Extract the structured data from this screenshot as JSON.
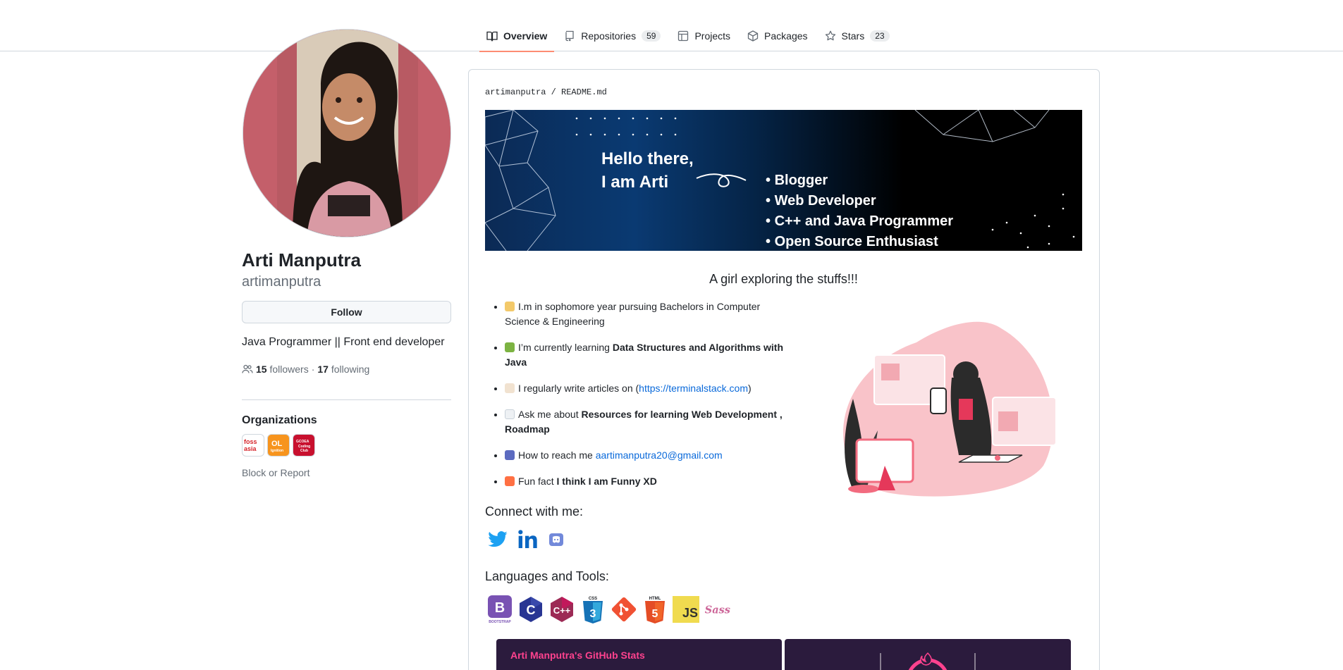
{
  "nav": {
    "tabs": [
      {
        "label": "Overview",
        "icon": "book-icon",
        "active": true
      },
      {
        "label": "Repositories",
        "icon": "repo-icon",
        "count": "59"
      },
      {
        "label": "Projects",
        "icon": "table-icon"
      },
      {
        "label": "Packages",
        "icon": "package-icon"
      },
      {
        "label": "Stars",
        "icon": "star-icon",
        "count": "23"
      }
    ]
  },
  "profile": {
    "name": "Arti Manputra",
    "login": "artimanputra",
    "follow_label": "Follow",
    "bio": "Java Programmer || Front end developer",
    "followers_count": "15",
    "followers_label": "followers",
    "separator": "·",
    "following_count": "17",
    "following_label": "following",
    "organizations_title": "Organizations",
    "orgs": [
      "foss asia",
      "OSL",
      "GCOEA Coding Club"
    ],
    "block_label": "Block or Report"
  },
  "readme": {
    "owner": "artimanputra",
    "slash": "/",
    "file": "README.md",
    "banner": {
      "hello_line1": "Hello there,",
      "hello_line2": "I am Arti",
      "items": [
        "Blogger",
        "Web Developer",
        "C++ and Java Programmer",
        "Open Source Enthusiast"
      ]
    },
    "tagline": "A girl exploring the stuffs!!!",
    "bullets": {
      "b1_text": "I.m in sophomore year pursuing Bachelors in Computer Science & Engineering",
      "b2_pre": "I’m currently learning ",
      "b2_bold": "Data Structures and Algorithms with Java",
      "b3_pre": "I regularly write articles on (",
      "b3_link": "https://terminalstack.com",
      "b3_post": ")",
      "b4_pre": "Ask me about ",
      "b4_bold": "Resources for learning Web Development , Roadmap",
      "b5_pre": "How to reach me ",
      "b5_link": "aartimanputra20@gmail.com",
      "b6_pre": "Fun fact ",
      "b6_bold": "I think I am Funny XD"
    },
    "connect_title": "Connect with me:",
    "socials": [
      "twitter-icon",
      "linkedin-icon",
      "discord-icon"
    ],
    "languages_title": "Languages and Tools:",
    "tools": [
      "bootstrap-icon",
      "c-icon",
      "cplusplus-icon",
      "css3-icon",
      "git-icon",
      "html5-icon",
      "javascript-icon",
      "sass-icon"
    ],
    "tool_text": {
      "bootstrap": "B",
      "bootstrap_caption": "BOOTSTRAP",
      "c": "C",
      "cpp": "C++",
      "css": "CSS",
      "css_n": "3",
      "html": "HTML",
      "html_n": "5",
      "js": "JS",
      "sass": "Sass"
    },
    "stats_title": "Arti Manputra's GitHub Stats"
  },
  "colors": {
    "accent_underline": "#fd8c73",
    "link": "#0969da",
    "stats_bg": "#2b1b3d",
    "stats_title": "#fe428e"
  }
}
